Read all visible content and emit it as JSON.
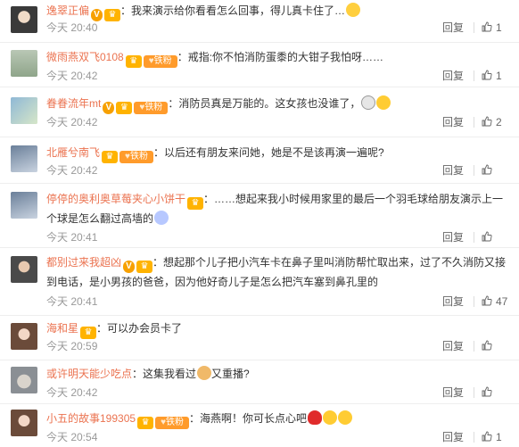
{
  "actions": {
    "reply_label": "回复"
  },
  "comments": [
    {
      "avatar_icon": "avatar-woman-portrait",
      "username": "逸翠正偏",
      "badges": [
        "v",
        "vip"
      ],
      "text": "：我来演示给你看看怎么回事，得儿真卡住了…",
      "trailing_emoji": "emoji-smiley",
      "time": "今天 20:40",
      "likes": "1"
    },
    {
      "avatar_icon": "avatar-landscape",
      "username": "微雨燕双飞0108",
      "badges": [
        "vip",
        "fan"
      ],
      "fan_label": "铁粉",
      "text": "：戒指:你不怕消防蛋黍的大钳子我怕呀……",
      "time": "今天 20:42",
      "likes": "1"
    },
    {
      "avatar_icon": "avatar-scenery",
      "username": "眷眷流年mt",
      "badges": [
        "v",
        "vip",
        "fan"
      ],
      "fan_label": "铁粉",
      "text": "：消防员真是万能的。这女孩也没谁了，",
      "trailing_emoji": "emoji-dog-face",
      "trailing_emoji2": "emoji-laugh",
      "time": "今天 20:42",
      "likes": "2"
    },
    {
      "avatar_icon": "avatar-character",
      "username": "北雁兮南飞",
      "badges": [
        "vip",
        "fan"
      ],
      "fan_label": "铁粉",
      "text": "：以后还有朋友来问她，她是不是该再演一遍呢?",
      "time": "今天 20:42",
      "likes": ""
    },
    {
      "avatar_icon": "avatar-character",
      "username": "停停的奥利奥草莓夹心小饼干",
      "badges": [
        "vip"
      ],
      "text": "：……想起来我小时候用家里的最后一个羽毛球给朋友演示上一",
      "text_line2": "个球是怎么翻过高墙的",
      "trailing_emoji": "emoji-shocked",
      "time": "今天 20:41",
      "likes": ""
    },
    {
      "avatar_icon": "avatar-person",
      "username": "都别过来我超凶",
      "badges": [
        "v",
        "vip"
      ],
      "text": "：想起那个儿子把小汽车卡在鼻子里叫消防帮忙取出来，过了不久消防又接",
      "text_line2": "到电话，是小男孩的爸爸，因为他好奇儿子是怎么把汽车塞到鼻孔里的",
      "time": "今天 20:41",
      "likes": "47"
    },
    {
      "avatar_icon": "avatar-girl",
      "username": "海和星",
      "badges": [
        "vip"
      ],
      "text": "：可以办会员卡了",
      "time": "今天 20:59",
      "likes": ""
    },
    {
      "avatar_icon": "avatar-cat",
      "username": "或许明天能少吃点",
      "badges": [],
      "text": "：这集我看过",
      "trailing_emoji": "emoji-cat",
      "text_after": "又重播?",
      "time": "今天 20:42",
      "likes": ""
    },
    {
      "avatar_icon": "avatar-girl",
      "username": "小五的故事199305",
      "badges": [
        "vip",
        "fan"
      ],
      "fan_label": "铁粉",
      "text": "：海燕啊！你可长点心吧",
      "trailing_emoji": "emoji-heart",
      "trailing_emoji2": "emoji-laugh",
      "trailing_emoji3": "emoji-laugh",
      "time": "今天 20:54",
      "likes": "1"
    }
  ],
  "colors": {
    "username": "#eb7350",
    "text": "#333333",
    "meta": "#999999",
    "vip_badge": "#ffb300",
    "fan_badge": "#ff9b2b"
  }
}
